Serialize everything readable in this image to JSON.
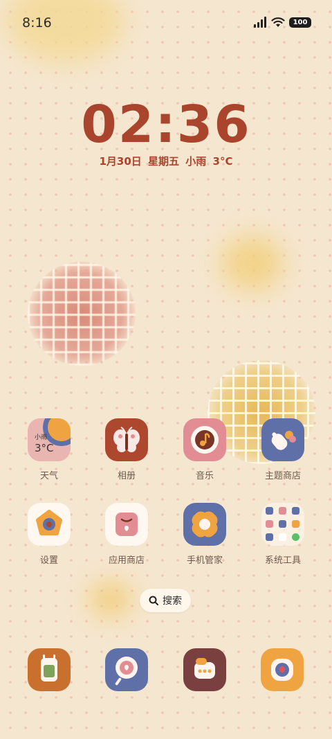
{
  "status_bar": {
    "time": "8:16",
    "battery": "100",
    "icons": [
      "signal-icon",
      "wifi-icon",
      "battery-icon"
    ]
  },
  "clock_widget": {
    "time": "02:36",
    "date": "1月30日",
    "weekday": "星期五",
    "weather": "小雨",
    "temperature": "3°C"
  },
  "apps": [
    {
      "label": "天气",
      "widget_weather": "小雨",
      "widget_temp": "3°C"
    },
    {
      "label": "相册"
    },
    {
      "label": "音乐"
    },
    {
      "label": "主题商店"
    },
    {
      "label": "设置"
    },
    {
      "label": "应用商店"
    },
    {
      "label": "手机管家"
    },
    {
      "label": "系统工具"
    }
  ],
  "search": {
    "label": "搜索"
  },
  "dock": [
    {
      "icon": "phone-app-icon"
    },
    {
      "icon": "browser-app-icon"
    },
    {
      "icon": "messages-app-icon"
    },
    {
      "icon": "camera-app-icon"
    }
  ],
  "colors": {
    "accent": "#a9452c",
    "background": "#f5e6cf",
    "tile_blue": "#5f6fa8",
    "tile_pink": "#e28d94",
    "tile_rust": "#ad472d"
  }
}
